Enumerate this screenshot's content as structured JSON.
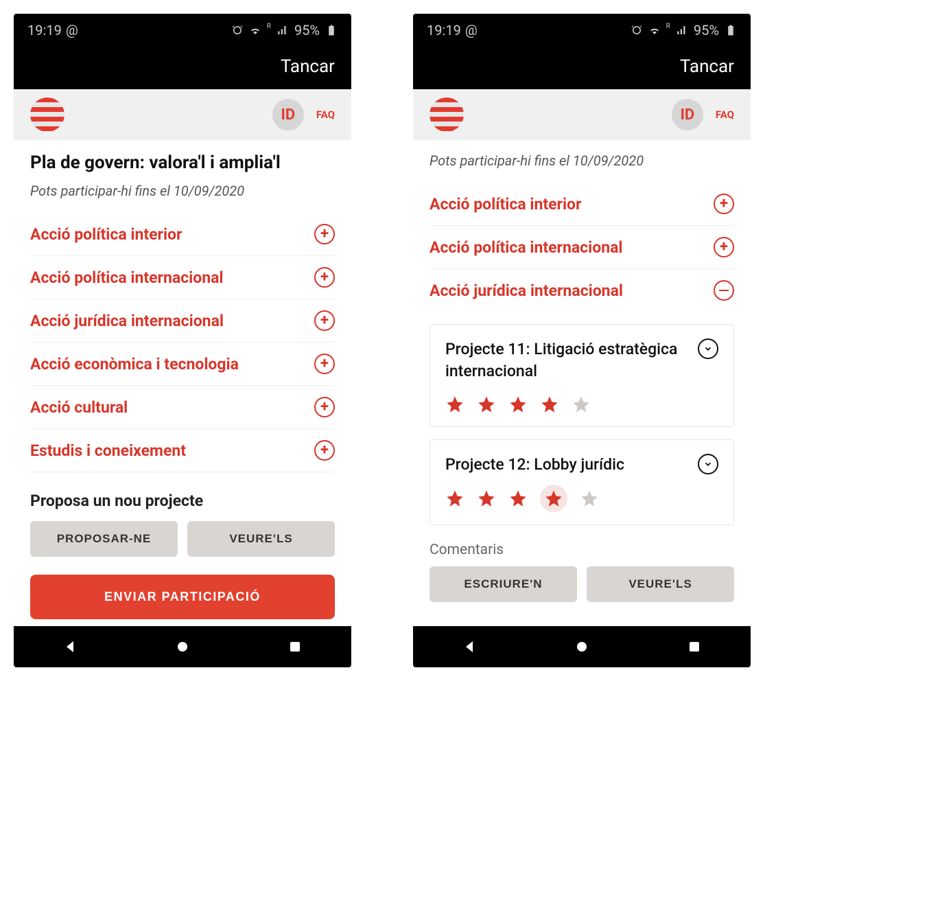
{
  "status": {
    "time": "19:19",
    "at": "@",
    "battery": "95%",
    "signal_label": "R"
  },
  "topbar": {
    "close": "Tancar"
  },
  "header": {
    "id_label": "ID",
    "faq": "FAQ"
  },
  "left": {
    "title": "Pla de govern: valora'l i amplia'l",
    "subtitle": "Pots participar-hi fins el 10/09/2020",
    "accordion": [
      {
        "label": "Acció política interior"
      },
      {
        "label": "Acció política internacional"
      },
      {
        "label": "Acció jurídica internacional"
      },
      {
        "label": "Acció econòmica i tecnologia"
      },
      {
        "label": "Acció cultural"
      },
      {
        "label": "Estudis i coneixement"
      }
    ],
    "propose_heading": "Proposa un nou projecte",
    "propose_button": "PROPOSAR-NE",
    "view_button": "VEURE'LS",
    "submit_button": "ENVIAR PARTICIPACIÓ"
  },
  "right": {
    "subtitle": "Pots participar-hi fins el 10/09/2020",
    "accordion": [
      {
        "label": "Acció política interior",
        "expanded": false
      },
      {
        "label": "Acció política internacional",
        "expanded": false
      },
      {
        "label": "Acció jurídica internacional",
        "expanded": true
      }
    ],
    "projects": [
      {
        "title": "Projecte 11: Litigació estratègica internacional",
        "rating": 4,
        "max": 5
      },
      {
        "title": "Projecte 12: Lobby jurídic",
        "rating": 4,
        "max": 5,
        "highlight_star": true
      }
    ],
    "comments_heading": "Comentaris",
    "write_button": "ESCRIURE'N",
    "view_button": "VEURE'LS"
  }
}
